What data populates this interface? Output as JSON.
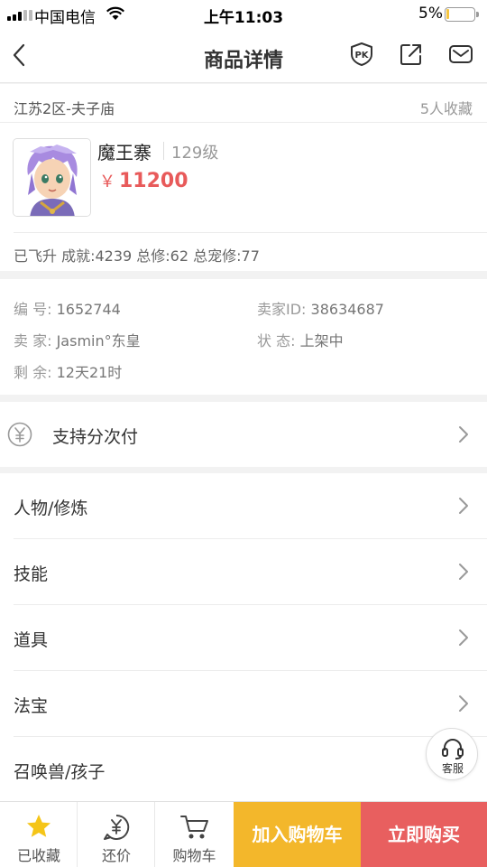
{
  "status_bar": {
    "carrier": "中国电信",
    "time": "上午11:03",
    "battery": "5%"
  },
  "nav": {
    "title": "商品详情",
    "icons": [
      "back-arrow-icon",
      "pk-compare-icon",
      "share-icon",
      "message-icon"
    ]
  },
  "product": {
    "region": "江苏2区-夫子庙",
    "favorite_count": "5人收藏",
    "role_name": "魔王寨",
    "level": "129级",
    "price_symbol": "￥",
    "price": "11200",
    "stats": "已飞升 成就:4239 总修:62 总宠修:77"
  },
  "details": {
    "id_label": "编    号:",
    "id_value": "1652744",
    "seller_id_label": "卖家ID:",
    "seller_id_value": "38634687",
    "seller_label": "卖    家:",
    "seller_value": "Jasmin°东皇",
    "status_label": "状    态:",
    "status_value": "上架中",
    "remaining_label": "剩    余:",
    "remaining_value": "12天21时"
  },
  "installment": {
    "label": "支持分次付",
    "icon": "yen-circle-icon"
  },
  "sections": [
    {
      "label": "人物/修炼"
    },
    {
      "label": "技能"
    },
    {
      "label": "道具"
    },
    {
      "label": "法宝"
    },
    {
      "label": "召唤兽/孩子"
    }
  ],
  "customer_service": {
    "label": "客服",
    "icon": "headset-icon"
  },
  "bottom_bar": {
    "favorited": "已收藏",
    "bargain": "还价",
    "cart": "购物车",
    "add_to_cart": "加入购物车",
    "buy_now": "立即购买"
  },
  "colors": {
    "price": "#e85a5a",
    "add_to_cart_bg": "#f3b72b",
    "buy_now_bg": "#e85f5f",
    "star": "#f5c518"
  }
}
